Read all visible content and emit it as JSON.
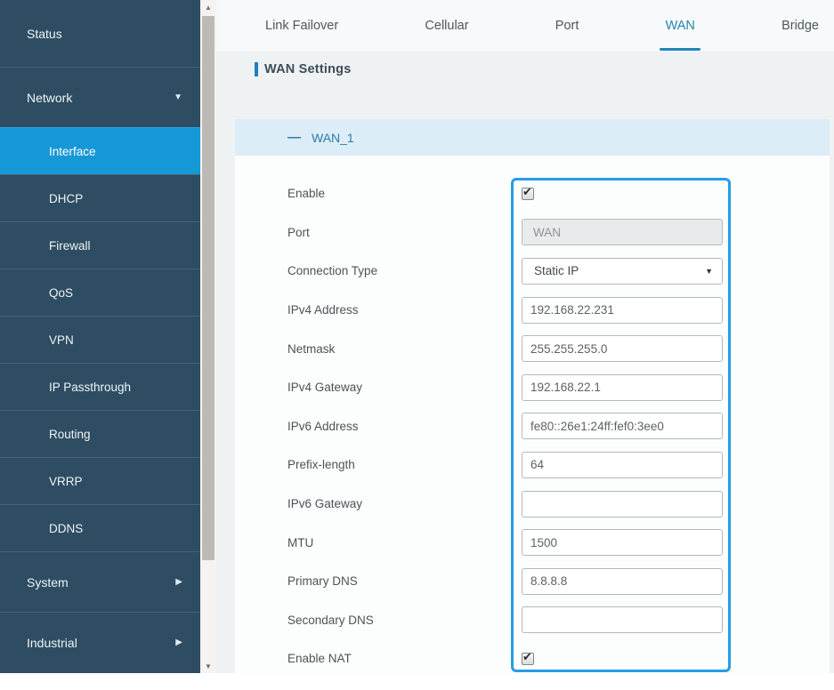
{
  "sidebar": {
    "items": [
      {
        "label": "Status",
        "level": "top",
        "arrow": null,
        "active": false
      },
      {
        "label": "Network",
        "level": "top",
        "arrow": "down",
        "active": false
      },
      {
        "label": "Interface",
        "level": "sub",
        "arrow": null,
        "active": true
      },
      {
        "label": "DHCP",
        "level": "sub",
        "arrow": null,
        "active": false
      },
      {
        "label": "Firewall",
        "level": "sub",
        "arrow": null,
        "active": false
      },
      {
        "label": "QoS",
        "level": "sub",
        "arrow": null,
        "active": false
      },
      {
        "label": "VPN",
        "level": "sub",
        "arrow": null,
        "active": false
      },
      {
        "label": "IP Passthrough",
        "level": "sub",
        "arrow": null,
        "active": false
      },
      {
        "label": "Routing",
        "level": "sub",
        "arrow": null,
        "active": false
      },
      {
        "label": "VRRP",
        "level": "sub",
        "arrow": null,
        "active": false
      },
      {
        "label": "DDNS",
        "level": "sub",
        "arrow": null,
        "active": false
      },
      {
        "label": "System",
        "level": "top",
        "arrow": "right",
        "active": false
      },
      {
        "label": "Industrial",
        "level": "top",
        "arrow": "right",
        "active": false
      }
    ]
  },
  "tabs": {
    "active": "WAN",
    "items": [
      {
        "label": "Link Failover"
      },
      {
        "label": "Cellular"
      },
      {
        "label": "Port"
      },
      {
        "label": "WAN"
      },
      {
        "label": "Bridge"
      }
    ]
  },
  "page": {
    "section_title": "WAN Settings",
    "panel_title": "WAN_1"
  },
  "form": {
    "fields": [
      {
        "label": "Enable",
        "type": "checkbox",
        "checked": true
      },
      {
        "label": "Port",
        "type": "text",
        "value": "WAN",
        "disabled": true
      },
      {
        "label": "Connection Type",
        "type": "select",
        "value": "Static IP"
      },
      {
        "label": "IPv4 Address",
        "type": "text",
        "value": "192.168.22.231"
      },
      {
        "label": "Netmask",
        "type": "text",
        "value": "255.255.255.0"
      },
      {
        "label": "IPv4 Gateway",
        "type": "text",
        "value": "192.168.22.1"
      },
      {
        "label": "IPv6 Address",
        "type": "text",
        "value": "fe80::26e1:24ff:fef0:3ee0"
      },
      {
        "label": "Prefix-length",
        "type": "text",
        "value": "64"
      },
      {
        "label": "IPv6 Gateway",
        "type": "text",
        "value": ""
      },
      {
        "label": "MTU",
        "type": "text",
        "value": "1500"
      },
      {
        "label": "Primary DNS",
        "type": "text",
        "value": "8.8.8.8"
      },
      {
        "label": "Secondary DNS",
        "type": "text",
        "value": ""
      },
      {
        "label": "Enable NAT",
        "type": "checkbox",
        "checked": true
      }
    ]
  },
  "icons": {
    "caret_down": "▼",
    "caret_right": "▶",
    "select_arrow": "▼",
    "checkmark": "✔",
    "collapse_minus": "—",
    "scroll_up": "▲",
    "scroll_down": "▼"
  },
  "colors": {
    "sidebar_bg": "#2e4d62",
    "sidebar_active_bg": "#1697d6",
    "tab_active": "#2684b0",
    "tab_underline": "#1d86bb",
    "band_bg": "#dcedf7",
    "band_text": "#2b7da4",
    "bluebox_border": "#259de6",
    "title_bar": "#1d7fc1"
  }
}
